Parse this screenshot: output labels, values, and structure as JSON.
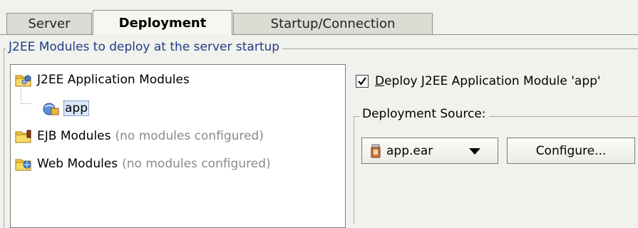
{
  "tabs": [
    {
      "label": "Server",
      "active": false
    },
    {
      "label": "Deployment",
      "active": true
    },
    {
      "label": "Startup/Connection",
      "active": false
    }
  ],
  "modules_group": {
    "legend": "J2EE Modules to deploy at the server startup"
  },
  "tree": {
    "j2ee_app_modules": {
      "label": "J2EE Application Modules"
    },
    "app_item": {
      "label": "app"
    },
    "ejb_modules": {
      "label": "EJB Modules",
      "note": "(no modules configured)"
    },
    "web_modules": {
      "label": "Web Modules",
      "note": "(no modules configured)"
    }
  },
  "deploy_checkbox": {
    "checked": true,
    "mnemonic": "D",
    "label_rest": "eploy J2EE Application Module 'app'"
  },
  "deployment_source": {
    "legend": "Deployment Source:",
    "selected": "app.ear",
    "configure_pre": "Confi",
    "configure_mnemonic": "g",
    "configure_post": "ure..."
  },
  "colors": {
    "background": "#f1f1ed",
    "legend_text": "#1f3d86",
    "selection": "#dbe6f7",
    "muted_text": "#8a8a8a"
  }
}
